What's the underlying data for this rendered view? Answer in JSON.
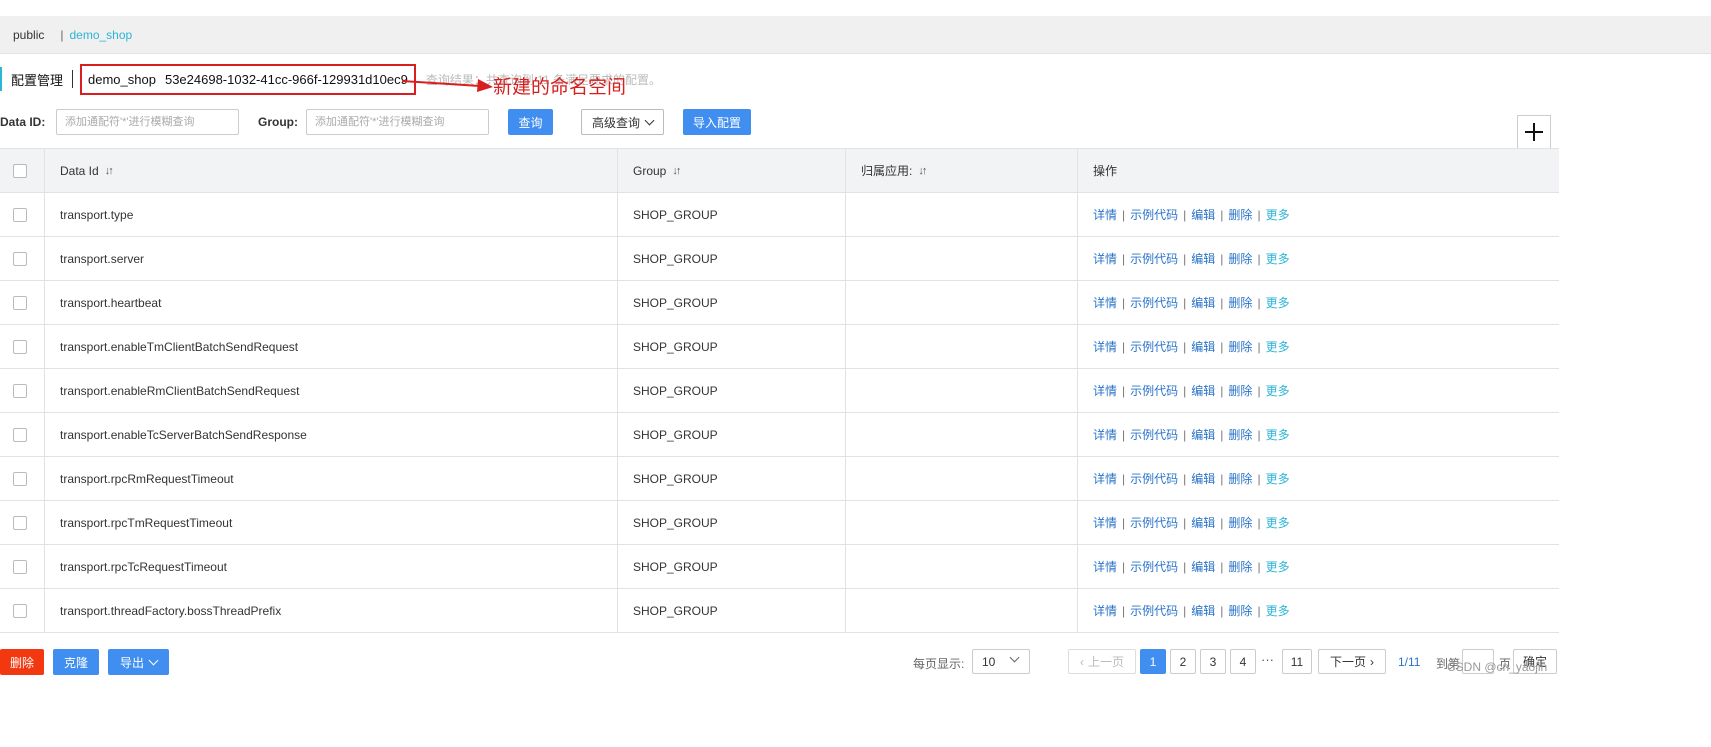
{
  "namespaces": {
    "items": [
      "public",
      "demo_shop"
    ],
    "separator": "|"
  },
  "header": {
    "title": "配置管理",
    "namespace_name": "demo_shop",
    "namespace_id": "53e24698-1032-41cc-966f-129931d10ec9",
    "query_result": "查询结果：共查询到 11 条满足要求的配置。"
  },
  "annotation": {
    "text": "新建的命名空间",
    "color": "#d71f1f"
  },
  "filters": {
    "data_id_label": "Data ID:",
    "data_id_placeholder": "添加通配符'*'进行模糊查询",
    "group_label": "Group:",
    "group_placeholder": "添加通配符'*'进行模糊查询",
    "query_button": "查询",
    "advanced_button": "高级查询",
    "import_button": "导入配置"
  },
  "table": {
    "columns": [
      "Data Id",
      "Group",
      "归属应用:",
      "操作"
    ],
    "rows": [
      {
        "data_id": "transport.type",
        "group": "SHOP_GROUP",
        "app": ""
      },
      {
        "data_id": "transport.server",
        "group": "SHOP_GROUP",
        "app": ""
      },
      {
        "data_id": "transport.heartbeat",
        "group": "SHOP_GROUP",
        "app": ""
      },
      {
        "data_id": "transport.enableTmClientBatchSendRequest",
        "group": "SHOP_GROUP",
        "app": ""
      },
      {
        "data_id": "transport.enableRmClientBatchSendRequest",
        "group": "SHOP_GROUP",
        "app": ""
      },
      {
        "data_id": "transport.enableTcServerBatchSendResponse",
        "group": "SHOP_GROUP",
        "app": ""
      },
      {
        "data_id": "transport.rpcRmRequestTimeout",
        "group": "SHOP_GROUP",
        "app": ""
      },
      {
        "data_id": "transport.rpcTmRequestTimeout",
        "group": "SHOP_GROUP",
        "app": ""
      },
      {
        "data_id": "transport.rpcTcRequestTimeout",
        "group": "SHOP_GROUP",
        "app": ""
      },
      {
        "data_id": "transport.threadFactory.bossThreadPrefix",
        "group": "SHOP_GROUP",
        "app": ""
      }
    ],
    "operations": {
      "details": "详情",
      "sample_code": "示例代码",
      "edit": "编辑",
      "delete": "删除",
      "more": "更多",
      "separator": "|"
    }
  },
  "footer": {
    "delete_button": "删除",
    "clone_button": "克隆",
    "export_button": "导出",
    "page_size_label": "每页显示:",
    "page_size": "10",
    "prev_button": "上一页",
    "pages": [
      "1",
      "2",
      "3",
      "4"
    ],
    "ellipsis": "···",
    "last_page": "11",
    "next_button": "下一页",
    "page_count": "1/11",
    "goto_label": "到第",
    "goto_unit": "页",
    "confirm_button": "确定"
  },
  "watermark": "CSDN @cn_yaojin",
  "colors": {
    "primary": "#3f8ef0",
    "link": "#2a74c9",
    "accent": "#2bb5d6",
    "danger": "#f1380e",
    "annotation": "#d71f1f"
  }
}
